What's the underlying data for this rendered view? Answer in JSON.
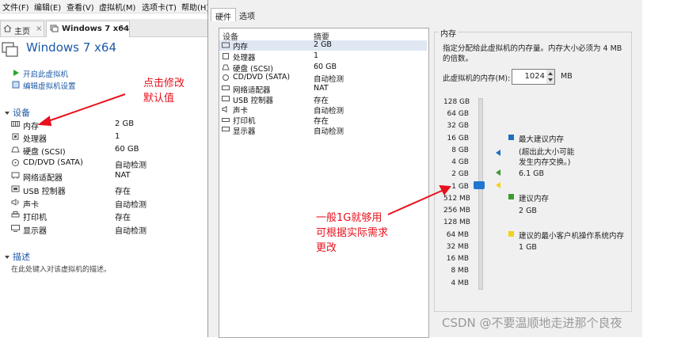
{
  "menu": [
    "文件(F)",
    "编辑(E)",
    "查看(V)",
    "虚拟机(M)",
    "选项卡(T)",
    "帮助(H)"
  ],
  "tabs": {
    "home": "主页",
    "vm": "Windows 7 x64"
  },
  "vm_title": "Windows 7 x64",
  "actions": {
    "power_on": "开启此虚拟机",
    "edit": "编辑虚拟机设置"
  },
  "devices_header": "设备",
  "devices": [
    {
      "name": "内存",
      "value": "2 GB",
      "icon": "memory-icon"
    },
    {
      "name": "处理器",
      "value": "1",
      "icon": "cpu-icon"
    },
    {
      "name": "硬盘 (SCSI)",
      "value": "60 GB",
      "icon": "disk-icon"
    },
    {
      "name": "CD/DVD (SATA)",
      "value": "自动检测",
      "icon": "cd-icon"
    },
    {
      "name": "网络适配器",
      "value": "NAT",
      "icon": "network-icon"
    },
    {
      "name": "USB 控制器",
      "value": "存在",
      "icon": "usb-icon"
    },
    {
      "name": "声卡",
      "value": "自动检测",
      "icon": "sound-icon"
    },
    {
      "name": "打印机",
      "value": "存在",
      "icon": "printer-icon"
    },
    {
      "name": "显示器",
      "value": "自动检测",
      "icon": "display-icon"
    }
  ],
  "description_header": "描述",
  "description_placeholder": "在此处键入对该虚拟机的描述。",
  "dialog": {
    "tab_hardware": "硬件",
    "tab_options": "选项",
    "col_device": "设备",
    "col_summary": "摘要",
    "memory_group": "内存",
    "memory_help": [
      "指定分配给此虚拟机的内存量。内存大小必须为 4 MB",
      "的倍数。"
    ],
    "memory_label": "此虚拟机的内存(M):",
    "memory_value": "1024",
    "memory_unit": "MB",
    "ticks": [
      "128 GB",
      "64 GB",
      "32 GB",
      "16 GB",
      "8 GB",
      "4 GB",
      "2 GB",
      "1 GB",
      "512 MB",
      "256 MB",
      "128 MB",
      "64 MB",
      "32 MB",
      "16 MB",
      "8 MB",
      "4 MB"
    ],
    "max_recommended_label": "最大建议内存",
    "max_recommended_note": [
      "(超出此大小可能",
      "发生内存交换。)"
    ],
    "max_recommended_value": "6.1 GB",
    "recommended_label": "建议内存",
    "recommended_value": "2 GB",
    "guest_min_label": "建议的最小客户机操作系统内存",
    "guest_min_value": "1 GB",
    "colors": {
      "max": "#1f6fbf",
      "recommended": "#3c9a2f",
      "guest_min": "#f2d21b"
    }
  },
  "annotations": {
    "left": [
      "点击修改",
      "默认值"
    ],
    "right": [
      "一般1G就够用",
      "可根据实际需求",
      "更改"
    ],
    "color": "#e8111d"
  },
  "watermark": "CSDN @不要温顺地走进那个良夜"
}
